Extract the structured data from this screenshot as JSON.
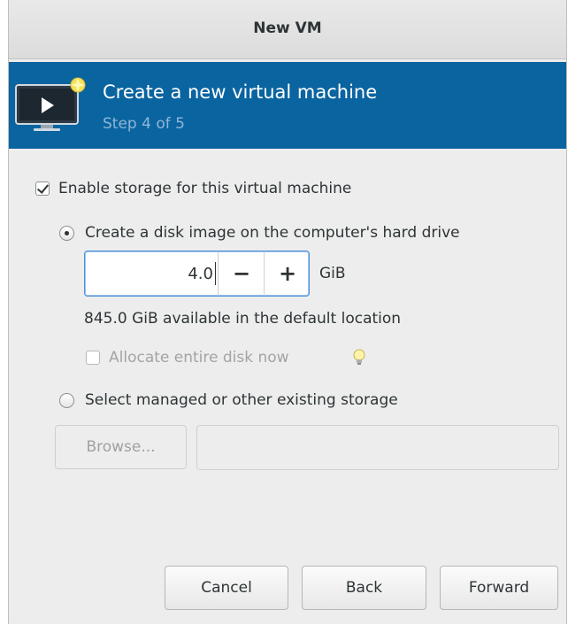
{
  "window": {
    "title": "New VM"
  },
  "banner": {
    "heading": "Create a new virtual machine",
    "step": "Step 4 of 5"
  },
  "storage": {
    "enable_label": "Enable storage for this virtual machine",
    "enable_checked": true,
    "create_disk_label": "Create a disk image on the computer's hard drive",
    "size_value": "4.0",
    "size_unit": "GiB",
    "minus_label": "−",
    "plus_label": "+",
    "available_text": "845.0 GiB available in the default location",
    "allocate_label": "Allocate entire disk now",
    "select_existing_label": "Select managed or other existing storage",
    "browse_label": "Browse...",
    "path_value": ""
  },
  "footer": {
    "cancel_label": "Cancel",
    "back_label": "Back",
    "forward_label": "Forward"
  },
  "icons": {
    "vm": "vm-monitor-icon",
    "hint": "lightbulb-icon"
  },
  "colors": {
    "banner": "#0a64a0",
    "focus": "#4a90d9"
  }
}
